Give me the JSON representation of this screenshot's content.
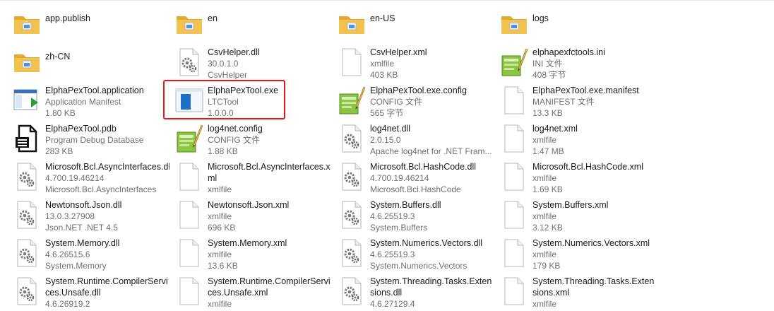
{
  "colors": {
    "folder": "#f2c14e",
    "folder_dark": "#e0a930",
    "highlight": "#e0191f"
  },
  "files": [
    {
      "icon": "folder-icon",
      "name": "app.publish",
      "lines": []
    },
    {
      "icon": "folder-icon",
      "name": "en",
      "lines": []
    },
    {
      "icon": "folder-icon",
      "name": "en-US",
      "lines": []
    },
    {
      "icon": "folder-icon",
      "name": "logs",
      "lines": []
    },
    {
      "icon": "folder-icon",
      "name": "zh-CN",
      "lines": []
    },
    {
      "icon": "dll-gear-icon",
      "name": "CsvHelper.dll",
      "lines": [
        "30.0.1.0",
        "CsvHelper"
      ]
    },
    {
      "icon": "blank-file-icon",
      "name": "CsvHelper.xml",
      "lines": [
        "xmlfile",
        "403 KB"
      ]
    },
    {
      "icon": "notepad-config-icon",
      "name": "elphapexfctools.ini",
      "lines": [
        "INI 文件",
        "408 字节"
      ]
    },
    {
      "icon": "application-manifest-icon",
      "name": "ElphaPexTool.application",
      "lines": [
        "Application Manifest",
        "1.80 KB"
      ]
    },
    {
      "icon": "exe-window-icon",
      "name": "ElphaPexTool.exe",
      "lines": [
        "LTCTool",
        "1.0.0.0"
      ]
    },
    {
      "icon": "notepad-config-icon",
      "name": "ElphaPexTool.exe.config",
      "lines": [
        "CONFIG 文件",
        "565 字节"
      ]
    },
    {
      "icon": "blank-file-icon",
      "name": "ElphaPexTool.exe.manifest",
      "lines": [
        "MANIFEST 文件",
        "13.3 KB"
      ]
    },
    {
      "icon": "pdb-document-icon",
      "name": "ElphaPexTool.pdb",
      "lines": [
        "Program Debug Database",
        "283 KB"
      ]
    },
    {
      "icon": "notepad-config-icon",
      "name": "log4net.config",
      "lines": [
        "CONFIG 文件",
        "1.88 KB"
      ]
    },
    {
      "icon": "dll-gear-icon",
      "name": "log4net.dll",
      "lines": [
        "2.0.15.0",
        "Apache log4net for .NET Fram..."
      ]
    },
    {
      "icon": "blank-file-icon",
      "name": "log4net.xml",
      "lines": [
        "xmlfile",
        "1.47 MB"
      ]
    },
    {
      "icon": "dll-gear-icon",
      "name": "Microsoft.Bcl.AsyncInterfaces.dll",
      "lines": [
        "4.700.19.46214",
        "Microsoft.Bcl.AsyncInterfaces"
      ]
    },
    {
      "icon": "blank-file-icon",
      "name": "Microsoft.Bcl.AsyncInterfaces.xml",
      "lines": [
        "xmlfile"
      ],
      "wrap": true
    },
    {
      "icon": "dll-gear-icon",
      "name": "Microsoft.Bcl.HashCode.dll",
      "lines": [
        "4.700.19.46214",
        "Microsoft.Bcl.HashCode"
      ]
    },
    {
      "icon": "blank-file-icon",
      "name": "Microsoft.Bcl.HashCode.xml",
      "lines": [
        "xmlfile",
        "1.69 KB"
      ]
    },
    {
      "icon": "dll-gear-icon",
      "name": "Newtonsoft.Json.dll",
      "lines": [
        "13.0.3.27908",
        "Json.NET .NET 4.5"
      ]
    },
    {
      "icon": "blank-file-icon",
      "name": "Newtonsoft.Json.xml",
      "lines": [
        "xmlfile",
        "696 KB"
      ]
    },
    {
      "icon": "dll-gear-icon",
      "name": "System.Buffers.dll",
      "lines": [
        "4.6.25519.3",
        "System.Buffers"
      ]
    },
    {
      "icon": "blank-file-icon",
      "name": "System.Buffers.xml",
      "lines": [
        "xmlfile",
        "3.12 KB"
      ]
    },
    {
      "icon": "dll-gear-icon",
      "name": "System.Memory.dll",
      "lines": [
        "4.6.26515.6",
        "System.Memory"
      ]
    },
    {
      "icon": "blank-file-icon",
      "name": "System.Memory.xml",
      "lines": [
        "xmlfile",
        "13.6 KB"
      ]
    },
    {
      "icon": "dll-gear-icon",
      "name": "System.Numerics.Vectors.dll",
      "lines": [
        "4.6.25519.3",
        "System.Numerics.Vectors"
      ]
    },
    {
      "icon": "blank-file-icon",
      "name": "System.Numerics.Vectors.xml",
      "lines": [
        "xmlfile",
        "179 KB"
      ]
    },
    {
      "icon": "dll-gear-icon",
      "name": "System.Runtime.CompilerServices.Unsafe.dll",
      "lines": [
        "4.6.26919.2"
      ],
      "wrap": true
    },
    {
      "icon": "blank-file-icon",
      "name": "System.Runtime.CompilerServices.Unsafe.xml",
      "lines": [
        "xmlfile"
      ],
      "wrap": true
    },
    {
      "icon": "dll-gear-icon",
      "name": "System.Threading.Tasks.Extensions.dll",
      "lines": [
        "4.6.27129.4"
      ],
      "wrap": true
    },
    {
      "icon": "blank-file-icon",
      "name": "System.Threading.Tasks.Extensions.xml",
      "lines": [
        "xmlfile"
      ],
      "wrap": true
    }
  ]
}
